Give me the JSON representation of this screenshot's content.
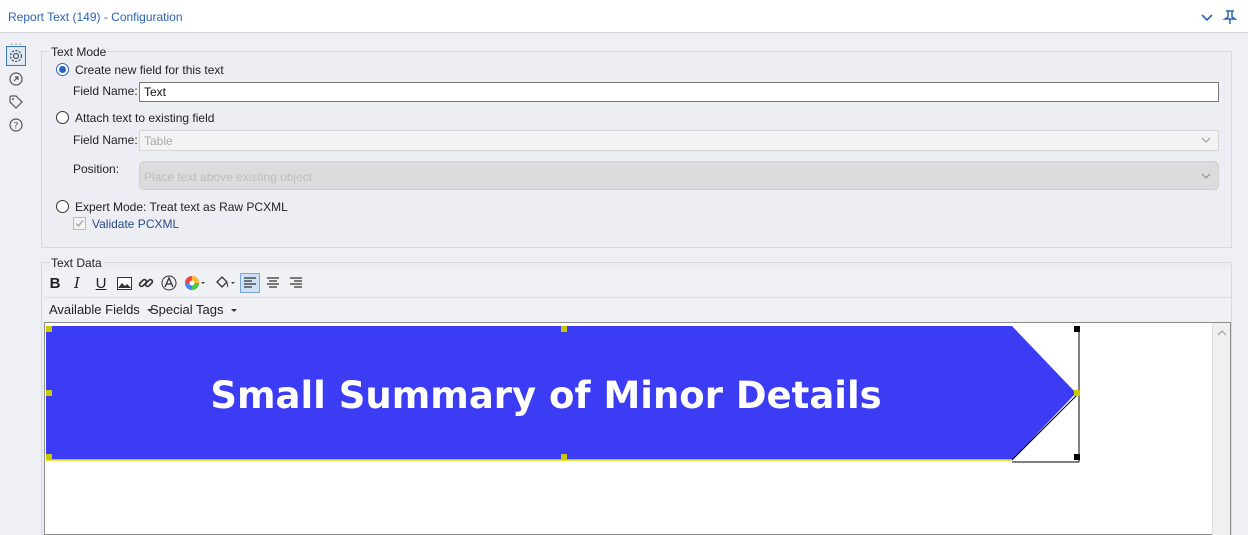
{
  "window": {
    "title": "Report Text (149) - Configuration",
    "accent": "#2a64b8"
  },
  "sidebar": {
    "dots": "...",
    "icons": [
      "gear-icon",
      "connection-icon",
      "tag-icon",
      "help-icon"
    ]
  },
  "text_mode": {
    "legend": "Text Mode",
    "option_new": {
      "label": "Create new field for this text",
      "checked": true
    },
    "field_name_label": "Field Name:",
    "field_name_value": "Text",
    "option_attach": {
      "label": "Attach text to existing field",
      "checked": false
    },
    "attach_field_label": "Field Name:",
    "attach_field_value": "Table",
    "position_label": "Position:",
    "position_value": "Place text above existing object",
    "option_expert": {
      "label": "Expert Mode: Treat text as Raw PCXML",
      "checked": false
    },
    "validate_label": "Validate PCXML",
    "validate_checked": true
  },
  "text_data": {
    "legend": "Text Data",
    "toolbar": {
      "bold": "B",
      "italic": "I",
      "underline": "U",
      "available_fields": "Available Fields",
      "special_tags": "Special Tags"
    },
    "banner": {
      "text": "Small Summary of Minor Details",
      "color": "#3c3cf5"
    }
  }
}
